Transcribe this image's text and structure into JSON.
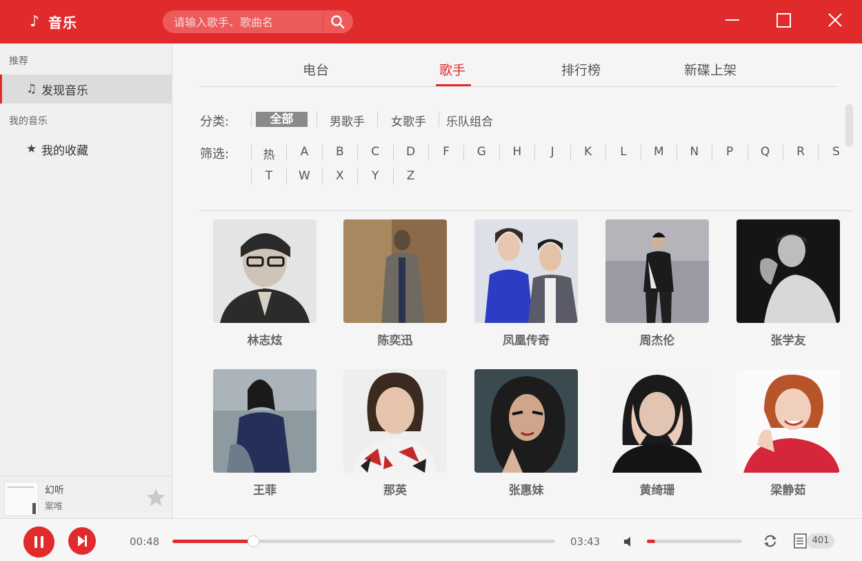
{
  "app": {
    "title": "音乐",
    "accent": "#e12a2b"
  },
  "search": {
    "placeholder": "请输入歌手、歌曲名"
  },
  "sidebar": {
    "sections": [
      {
        "title": "推荐",
        "items": [
          {
            "label": "发现音乐",
            "icon": "music-note-icon",
            "active": true
          }
        ]
      },
      {
        "title": "我的音乐",
        "items": [
          {
            "label": "我的收藏",
            "icon": "star-icon",
            "active": false
          }
        ]
      }
    ]
  },
  "now_playing": {
    "title": "幻听",
    "artist": "案唯"
  },
  "tabs": [
    {
      "label": "电台",
      "active": false
    },
    {
      "label": "歌手",
      "active": true
    },
    {
      "label": "排行榜",
      "active": false
    },
    {
      "label": "新碟上架",
      "active": false
    }
  ],
  "filters": {
    "category_label": "分类:",
    "categories": [
      "全部",
      "男歌手",
      "女歌手",
      "乐队组合"
    ],
    "active_category": "全部",
    "screen_label": "筛选:",
    "letters": [
      "热",
      "A",
      "B",
      "C",
      "D",
      "F",
      "G",
      "H",
      "J",
      "K",
      "L",
      "M",
      "N",
      "P",
      "Q",
      "R",
      "S",
      "T",
      "W",
      "X",
      "Y",
      "Z"
    ]
  },
  "artists": [
    {
      "name": "林志炫"
    },
    {
      "name": "陈奕迅"
    },
    {
      "name": "凤凰传奇"
    },
    {
      "name": "周杰伦"
    },
    {
      "name": "张学友"
    },
    {
      "name": "王菲"
    },
    {
      "name": "那英"
    },
    {
      "name": "张惠妹"
    },
    {
      "name": "黄绮珊"
    },
    {
      "name": "梁静茹"
    }
  ],
  "player": {
    "current_time": "00:48",
    "total_time": "03:43",
    "progress": 0.21,
    "volume": 0.09,
    "playlist_count": "401"
  }
}
